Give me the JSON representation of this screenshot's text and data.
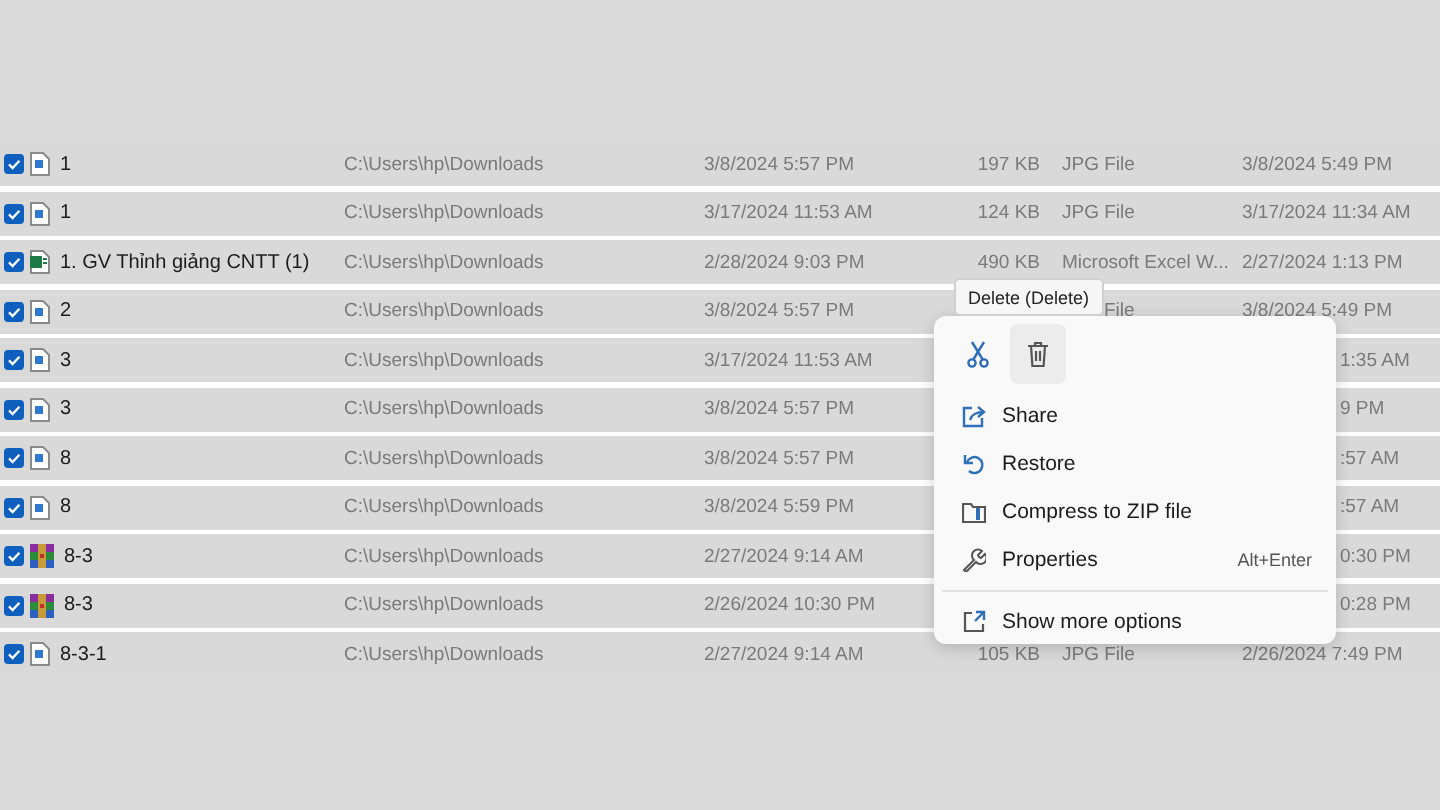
{
  "rows": [
    {
      "checked": true,
      "kind": "image",
      "name": "1",
      "path": "C:\\Users\\hp\\Downloads",
      "date": "3/8/2024 5:57 PM",
      "size": "197 KB",
      "type": "JPG File",
      "modified": "3/8/2024 5:49 PM"
    },
    {
      "checked": true,
      "kind": "image",
      "name": "1",
      "path": "C:\\Users\\hp\\Downloads",
      "date": "3/17/2024 11:53 AM",
      "size": "124 KB",
      "type": "JPG File",
      "modified": "3/17/2024 11:34 AM"
    },
    {
      "checked": true,
      "kind": "excel",
      "name": "1. GV Thỉnh giảng CNTT (1)",
      "path": "C:\\Users\\hp\\Downloads",
      "date": "2/28/2024 9:03 PM",
      "size": "490 KB",
      "type": "Microsoft Excel W...",
      "modified": "2/27/2024 1:13 PM"
    },
    {
      "checked": true,
      "kind": "image",
      "name": "2",
      "path": "C:\\Users\\hp\\Downloads",
      "date": "3/8/2024 5:57 PM",
      "type": "File",
      "modified": "3/8/2024 5:49 PM"
    },
    {
      "checked": true,
      "kind": "image",
      "name": "3",
      "path": "C:\\Users\\hp\\Downloads",
      "date": "3/17/2024 11:53 AM",
      "modified": "1:35 AM"
    },
    {
      "checked": true,
      "kind": "image",
      "name": "3",
      "path": "C:\\Users\\hp\\Downloads",
      "date": "3/8/2024 5:57 PM",
      "modified": "9 PM"
    },
    {
      "checked": true,
      "kind": "image",
      "name": "8",
      "path": "C:\\Users\\hp\\Downloads",
      "date": "3/8/2024 5:57 PM",
      "modified": ":57 AM"
    },
    {
      "checked": true,
      "kind": "image",
      "name": "8",
      "path": "C:\\Users\\hp\\Downloads",
      "date": "3/8/2024 5:59 PM",
      "modified": ":57 AM"
    },
    {
      "checked": true,
      "kind": "archive",
      "name": "8-3",
      "path": "C:\\Users\\hp\\Downloads",
      "date": "2/27/2024 9:14 AM",
      "modified": "0:30 PM"
    },
    {
      "checked": true,
      "kind": "archive",
      "name": "8-3",
      "path": "C:\\Users\\hp\\Downloads",
      "date": "2/26/2024 10:30 PM",
      "modified": "0:28 PM"
    },
    {
      "checked": true,
      "kind": "image",
      "name": "8-3-1",
      "path": "C:\\Users\\hp\\Downloads",
      "date": "2/27/2024 9:14 AM",
      "size": "105 KB",
      "type": "JPG File",
      "modified": "2/26/2024 7:49 PM"
    }
  ],
  "tooltip": "Delete (Delete)",
  "context_menu": {
    "icon_buttons": [
      {
        "kind": "cut",
        "selected": false
      },
      {
        "kind": "delete",
        "selected": true
      }
    ],
    "groups": [
      [
        {
          "kind": "share",
          "label": "Share"
        },
        {
          "kind": "restore",
          "label": "Restore"
        },
        {
          "kind": "zip",
          "label": "Compress to ZIP file"
        },
        {
          "kind": "properties",
          "label": "Properties",
          "shortcut": "Alt+Enter"
        }
      ],
      [
        {
          "kind": "more",
          "label": "Show more options"
        }
      ]
    ]
  }
}
